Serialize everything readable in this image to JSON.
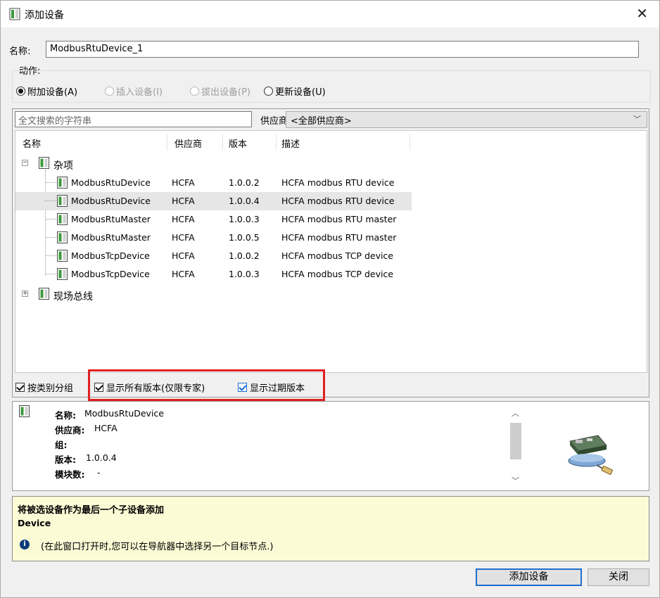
{
  "dialog": {
    "title": "添加设备",
    "close": "✕"
  },
  "name": {
    "label": "名称:",
    "value": "ModbusRtuDevice_1"
  },
  "action": {
    "label": "动作:",
    "options": [
      {
        "label": "附加设备(A)",
        "checked": true,
        "enabled": true
      },
      {
        "label": "插入设备(I)",
        "checked": false,
        "enabled": false
      },
      {
        "label": "拔出设备(P)",
        "checked": false,
        "enabled": false
      },
      {
        "label": "更新设备(U)",
        "checked": false,
        "enabled": true
      }
    ]
  },
  "filter": {
    "search_placeholder": "全文搜索的字符串",
    "vendor_label": "供应商:",
    "vendor_value": "<全部供应商>"
  },
  "tree": {
    "columns": [
      "名称",
      "供应商",
      "版本",
      "描述"
    ],
    "groups": [
      {
        "name": "杂项",
        "expanded": true
      },
      {
        "name": "现场总线",
        "expanded": false
      }
    ],
    "rows": [
      {
        "name": "ModbusRtuDevice",
        "vendor": "HCFA",
        "version": "1.0.0.2",
        "desc": "HCFA modbus RTU device"
      },
      {
        "name": "ModbusRtuDevice",
        "vendor": "HCFA",
        "version": "1.0.0.4",
        "desc": "HCFA modbus RTU device",
        "selected": true
      },
      {
        "name": "ModbusRtuMaster",
        "vendor": "HCFA",
        "version": "1.0.0.3",
        "desc": "HCFA modbus RTU master"
      },
      {
        "name": "ModbusRtuMaster",
        "vendor": "HCFA",
        "version": "1.0.0.5",
        "desc": "HCFA modbus RTU master"
      },
      {
        "name": "ModbusTcpDevice",
        "vendor": "HCFA",
        "version": "1.0.0.2",
        "desc": "HCFA modbus TCP device"
      },
      {
        "name": "ModbusTcpDevice",
        "vendor": "HCFA",
        "version": "1.0.0.3",
        "desc": "HCFA modbus TCP device"
      }
    ]
  },
  "options": {
    "group_by_category": "按类别分组",
    "show_all_versions": "显示所有版本(仅限专家)",
    "show_outdated": "显示过期版本"
  },
  "details": {
    "name_key": "名称:",
    "name_val": "ModbusRtuDevice",
    "vendor_key": "供应商:",
    "vendor_val": "HCFA",
    "group_key": "组:",
    "version_key": "版本:",
    "version_val": "1.0.0.4",
    "modules_key": "模块数:",
    "modules_val": "-"
  },
  "hint": {
    "title": "将被选设备作为最后一个子设备添加",
    "subtitle": "Device",
    "info_icon": "i",
    "text": "(在此窗口打开时,您可以在导航器中选择另一个目标节点.)"
  },
  "buttons": {
    "add": "添加设备",
    "close": "关闭"
  },
  "colors": {
    "highlight": "#e02020",
    "hint_bg": "#fbfbd6",
    "primary_border": "#1c6fce"
  }
}
